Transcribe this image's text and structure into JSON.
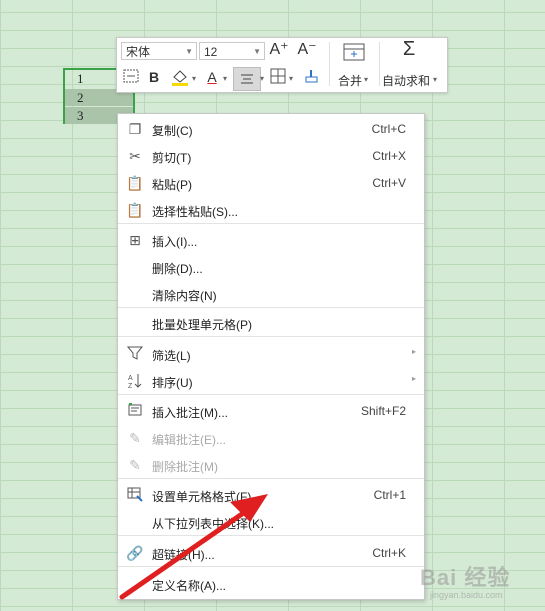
{
  "cells": [
    "1",
    "2",
    "3"
  ],
  "toolbar": {
    "font_name": "宋体",
    "font_size": "12",
    "grow_font": "A⁺",
    "shrink_font": "A⁻",
    "merge_label": "合并",
    "autosum_label": "自动求和"
  },
  "menu": [
    {
      "label": "复制(C)",
      "shortcut": "Ctrl+C",
      "icon": "copy-icon"
    },
    {
      "label": "剪切(T)",
      "shortcut": "Ctrl+X",
      "icon": "cut-icon"
    },
    {
      "label": "粘贴(P)",
      "shortcut": "Ctrl+V",
      "icon": "paste-icon"
    },
    {
      "label": "选择性粘贴(S)...",
      "shortcut": "",
      "icon": "paste-special-icon"
    },
    {
      "label": "插入(I)...",
      "shortcut": "",
      "icon": "insert-icon"
    },
    {
      "label": "删除(D)...",
      "shortcut": ""
    },
    {
      "label": "清除内容(N)",
      "shortcut": ""
    },
    {
      "label": "批量处理单元格(P)",
      "shortcut": ""
    },
    {
      "label": "筛选(L)",
      "shortcut": "",
      "icon": "filter-icon"
    },
    {
      "label": "排序(U)",
      "shortcut": "",
      "icon": "sort-icon"
    },
    {
      "label": "插入批注(M)...",
      "shortcut": "Shift+F2",
      "icon": "comment-icon"
    },
    {
      "label": "编辑批注(E)...",
      "shortcut": "",
      "icon": "edit-comment-icon"
    },
    {
      "label": "删除批注(M)",
      "shortcut": "",
      "icon": "delete-comment-icon"
    },
    {
      "label": "设置单元格格式(F)...",
      "shortcut": "Ctrl+1",
      "icon": "format-cells-icon"
    },
    {
      "label": "从下拉列表中选择(K)...",
      "shortcut": ""
    },
    {
      "label": "超链接(H)...",
      "shortcut": "Ctrl+K",
      "icon": "hyperlink-icon"
    },
    {
      "label": "定义名称(A)...",
      "shortcut": ""
    }
  ],
  "watermark": "Bai 经验",
  "watermark_sub": "jingyan.baidu.com",
  "colors": {
    "accent_arrow": "#e02020",
    "selection": "#3aa34a"
  }
}
